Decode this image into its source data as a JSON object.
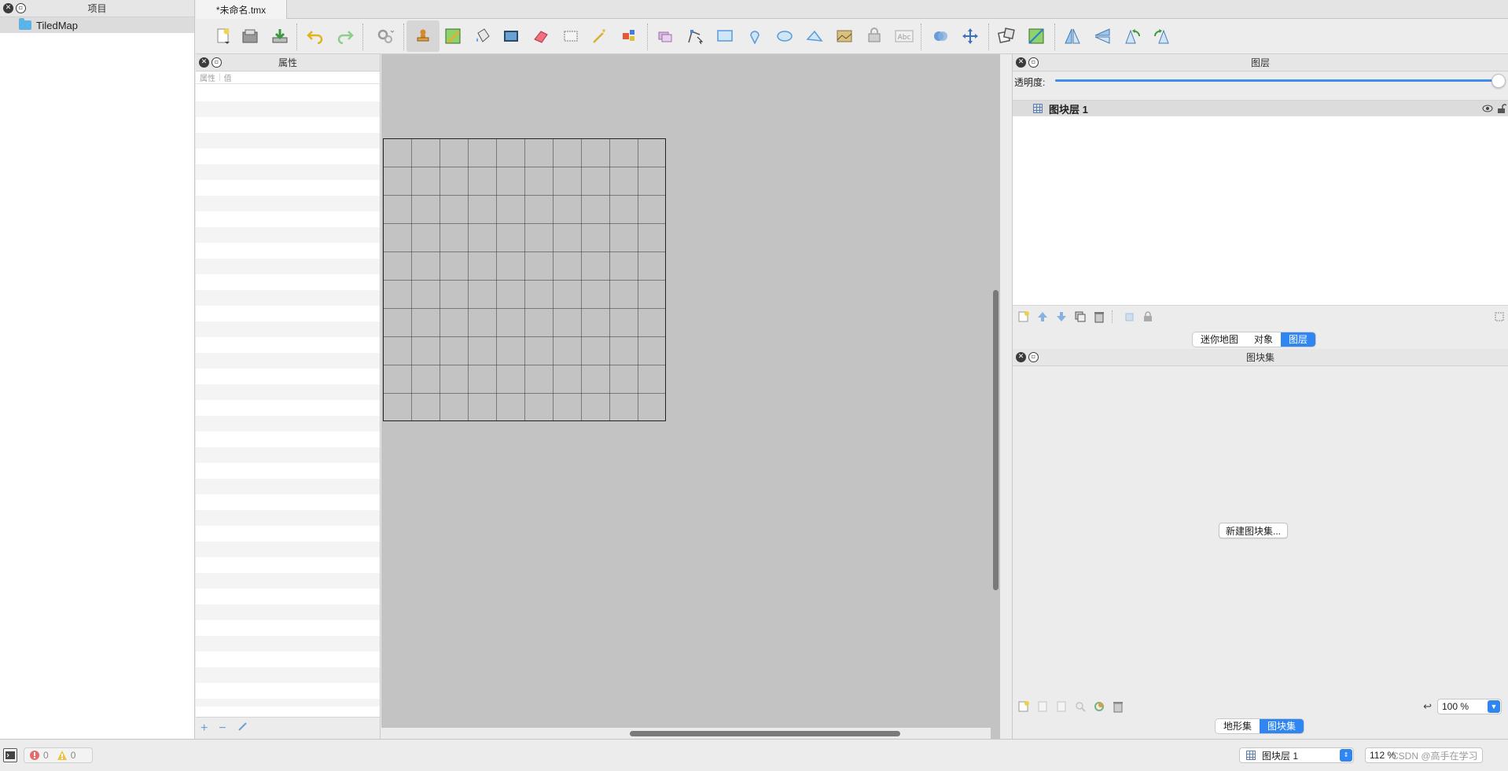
{
  "project_panel": {
    "title": "项目",
    "items": [
      {
        "label": "TiledMap"
      }
    ]
  },
  "tabs": [
    {
      "label": "*未命名.tmx"
    }
  ],
  "properties_panel": {
    "title": "属性",
    "columns": [
      "属性",
      "值"
    ],
    "bottom_buttons": [
      "+",
      "−"
    ]
  },
  "layers_panel": {
    "title": "图层",
    "opacity_label": "透明度:",
    "opacity_value": 1.0,
    "layers": [
      {
        "name": "图块层 1",
        "visible": true
      }
    ],
    "tabs": [
      {
        "label": "迷你地图"
      },
      {
        "label": "对象"
      },
      {
        "label": "图层"
      }
    ],
    "active_tab": "图层"
  },
  "tilesets_panel": {
    "title": "图块集",
    "new_tileset_label": "新建图块集...",
    "zoom": "100 %",
    "tabs": [
      {
        "label": "地形集"
      },
      {
        "label": "图块集"
      }
    ],
    "active_tab": "图块集"
  },
  "statusbar": {
    "errors": "0",
    "warnings": "0",
    "current_layer": "图块层 1",
    "zoom": "112 %",
    "watermark": "CSDN @高手在学习"
  },
  "map": {
    "columns": 10,
    "rows": 10
  },
  "colors": {
    "accent": "#2f86f0",
    "canvas": "#c3c3c3",
    "panel": "#ececec"
  }
}
